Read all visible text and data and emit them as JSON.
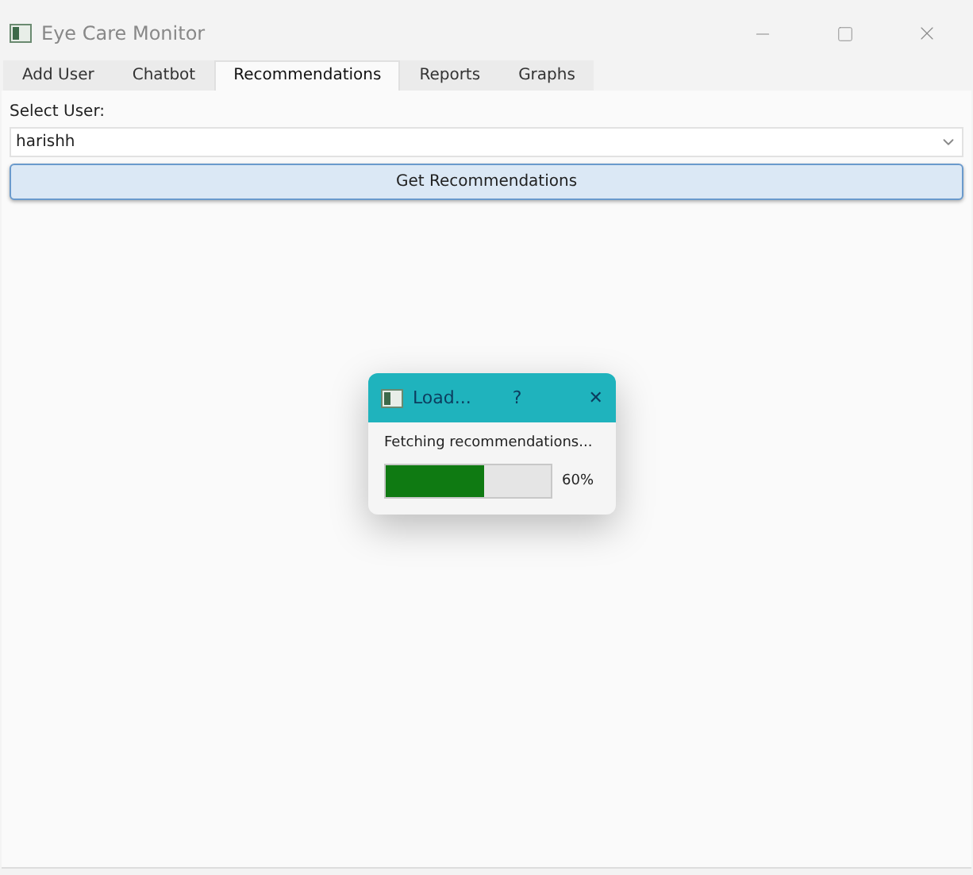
{
  "window": {
    "title": "Eye Care Monitor"
  },
  "tabs": [
    {
      "label": "Add User",
      "selected": false
    },
    {
      "label": "Chatbot",
      "selected": false
    },
    {
      "label": "Recommendations",
      "selected": true
    },
    {
      "label": "Reports",
      "selected": false
    },
    {
      "label": "Graphs",
      "selected": false
    }
  ],
  "user_select": {
    "label": "Select User:",
    "value": "harishh"
  },
  "action_button": "Get Recommendations",
  "dialog": {
    "title": "Load...",
    "help": "?",
    "close": "✕",
    "message": "Fetching recommendations...",
    "level": 0.6,
    "reading": "60%"
  }
}
